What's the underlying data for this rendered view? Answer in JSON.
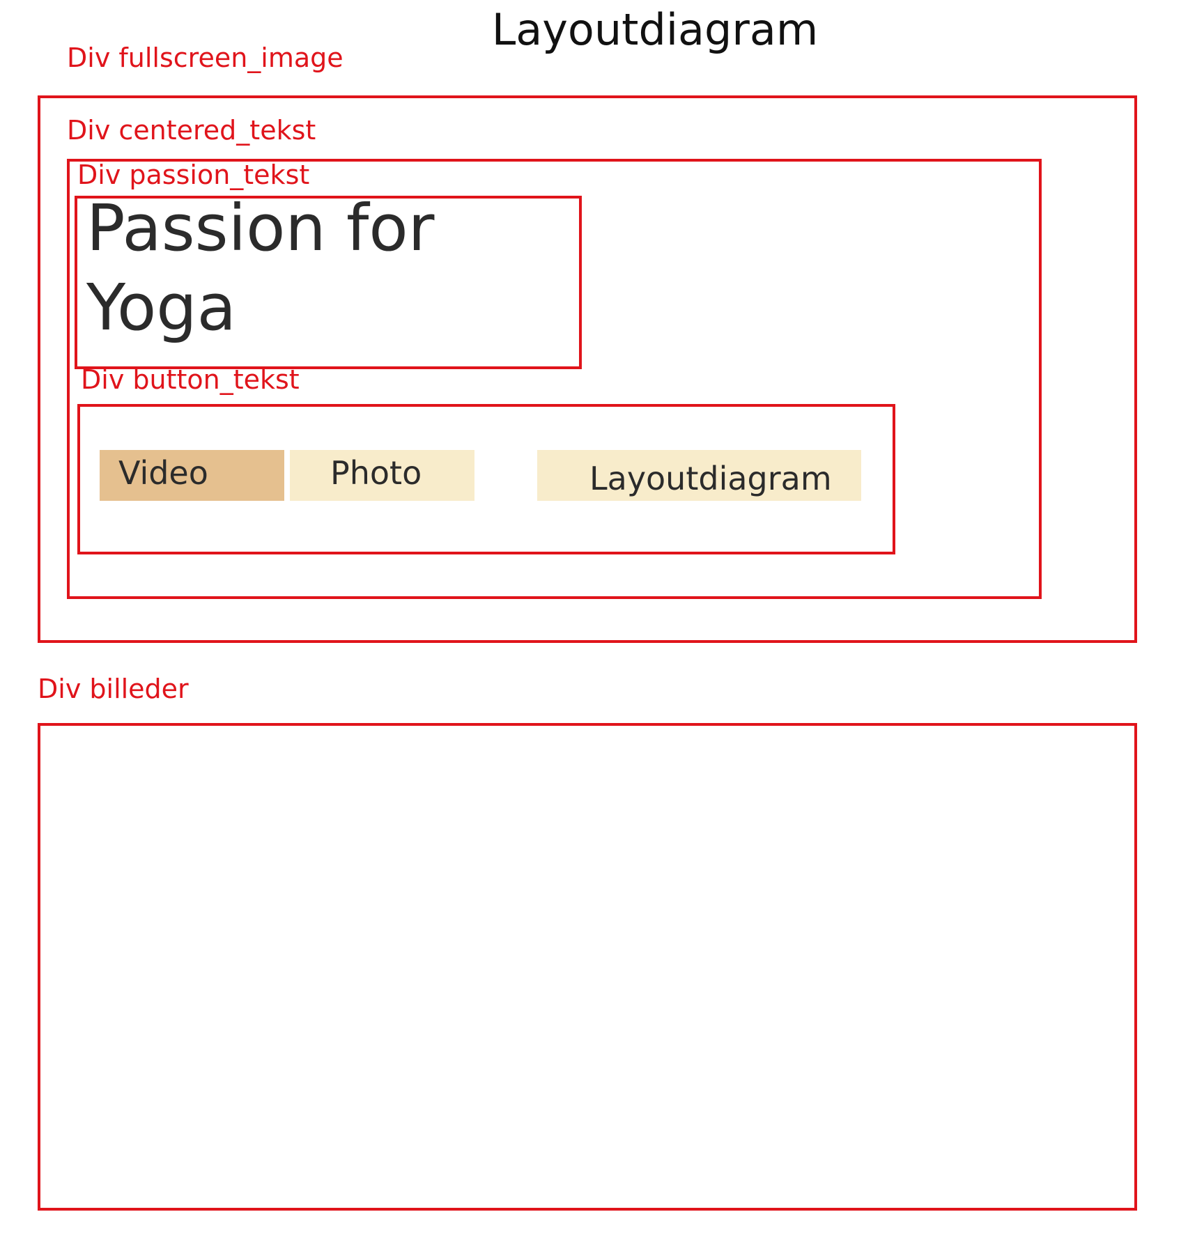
{
  "title": "Layoutdiagram",
  "colors": {
    "outline": "#e0141b",
    "button_active": "#e5c08f",
    "button_inactive": "#f8eccb",
    "text": "#2b2b2b"
  },
  "labels": {
    "fullscreen_image": "Div fullscreen_image",
    "centered_tekst": "Div centered_tekst",
    "passion_tekst": "Div passion_tekst",
    "button_tekst": "Div button_tekst",
    "billeder": "Div billeder"
  },
  "heading": {
    "line1": "Passion for",
    "line2": "Yoga"
  },
  "buttons": [
    {
      "label": "Video",
      "active": true
    },
    {
      "label": "Photo",
      "active": false
    },
    {
      "label": "Layoutdiagram",
      "active": false
    }
  ]
}
